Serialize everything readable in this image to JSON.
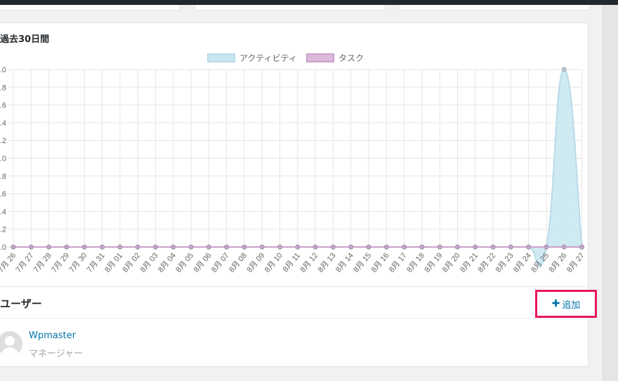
{
  "chart_section": {
    "title": "過去30日間"
  },
  "chart_data": {
    "type": "area",
    "categories": [
      "7月 26",
      "7月 27",
      "7月 28",
      "7月 29",
      "7月 30",
      "7月 31",
      "8月 01",
      "8月 02",
      "8月 03",
      "8月 04",
      "8月 05",
      "8月 06",
      "8月 07",
      "8月 08",
      "8月 09",
      "8月 10",
      "8月 11",
      "8月 12",
      "8月 13",
      "8月 14",
      "8月 15",
      "8月 16",
      "8月 17",
      "8月 18",
      "8月 19",
      "8月 20",
      "8月 21",
      "8月 22",
      "8月 23",
      "8月 24",
      "8月 25",
      "8月 26",
      "8月 27"
    ],
    "series": [
      {
        "name": "アクティビティ",
        "color": "#c8e6f0",
        "stroke": "#b7dbe8",
        "values": [
          0,
          0,
          0,
          0,
          0,
          0,
          0,
          0,
          0,
          0,
          0,
          0,
          0,
          0,
          0,
          0,
          0,
          0,
          0,
          0,
          0,
          0,
          0,
          0,
          0,
          0,
          0,
          0,
          0,
          0,
          0,
          1,
          0
        ]
      },
      {
        "name": "タスク",
        "color": "#dcbadb",
        "stroke": "#c9a1c8",
        "values": [
          0,
          0,
          0,
          0,
          0,
          0,
          0,
          0,
          0,
          0,
          0,
          0,
          0,
          0,
          0,
          0,
          0,
          0,
          0,
          0,
          0,
          0,
          0,
          0,
          0,
          0,
          0,
          0,
          0,
          0,
          0,
          0,
          0
        ]
      }
    ],
    "y_ticks": [
      ".0",
      ".2",
      ".4",
      ".6",
      ".8",
      "1.0",
      "1.2",
      "1.4",
      "1.6",
      "1.8",
      "2.0"
    ],
    "ylim": [
      0,
      1
    ],
    "grid": true,
    "legend_position": "top-center"
  },
  "users_section": {
    "title": "ユーザー",
    "add_button_label": "追加",
    "add_button_icon": "plus-icon",
    "users": [
      {
        "name": "Wpmaster",
        "role": "マネージャー"
      }
    ]
  }
}
